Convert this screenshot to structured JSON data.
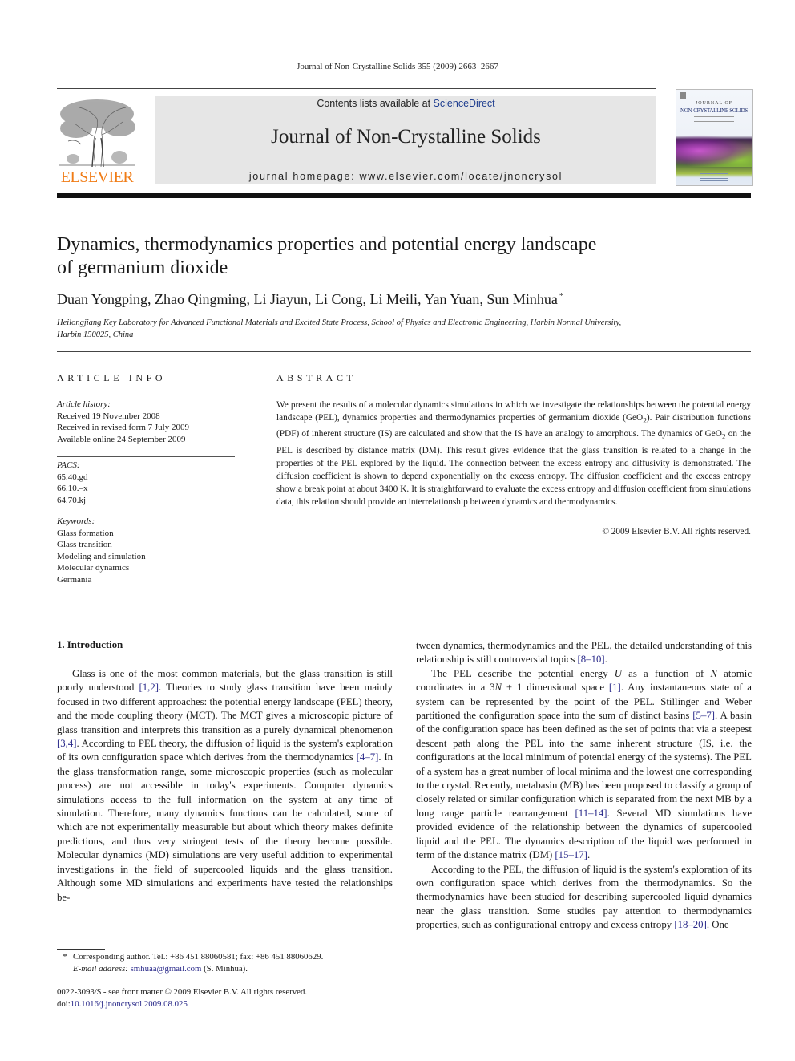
{
  "running_head": "Journal of Non-Crystalline Solids 355 (2009) 2663–2667",
  "masthead": {
    "publisher_logo_icon": "elsevier-tree-icon",
    "publisher_name": "ELSEVIER",
    "contents_prefix": "Contents lists available at ",
    "contents_link": "ScienceDirect",
    "journal_name": "Journal of Non-Crystalline Solids",
    "homepage": "journal homepage: www.elsevier.com/locate/jnoncrysol",
    "cover": {
      "title_line1": "JOURNAL OF",
      "title_line2": "NON-CRYSTALLINE SOLIDS"
    },
    "colors": {
      "publisher_orange": "#f07c16",
      "link_blue": "#1e3d8f",
      "banner_gray": "#e6e6e6"
    }
  },
  "article": {
    "title_line1": "Dynamics, thermodynamics properties and potential energy landscape",
    "title_line2": "of germanium dioxide",
    "authors": "Duan Yongping, Zhao Qingming, Li Jiayun, Li Cong, Li Meili, Yan Yuan, Sun Minhua",
    "corresponding_mark": "*",
    "affiliation_line1": "Heilongjiang Key Laboratory for Advanced Functional Materials and Excited State Process, School of Physics and Electronic Engineering, Harbin Normal University,",
    "affiliation_line2": "Harbin 150025, China"
  },
  "article_info": {
    "heading": "ARTICLE INFO",
    "history_label": "Article history:",
    "history": [
      "Received 19 November 2008",
      "Received in revised form 7 July 2009",
      "Available online 24 September 2009"
    ],
    "pacs_label": "PACS:",
    "pacs": [
      "65.40.gd",
      "66.10.–x",
      "64.70.kj"
    ],
    "keywords_label": "Keywords:",
    "keywords": [
      "Glass formation",
      "Glass transition",
      "Modeling and simulation",
      "Molecular dynamics",
      "Germania"
    ]
  },
  "abstract": {
    "heading": "ABSTRACT",
    "text_part1": "We present the results of a molecular dynamics simulations in which we investigate the relationships between the potential energy landscape (PEL), dynamics properties and thermodynamics properties of germanium dioxide (GeO",
    "sub1": "2",
    "text_part2": "). Pair distribution functions (PDF) of inherent structure (IS) are calculated and show that the IS have an analogy to amorphous. The dynamics of GeO",
    "sub2": "2",
    "text_part3": " on the PEL is described by distance matrix (DM). This result gives evidence that the glass transition is related to a change in the properties of the PEL explored by the liquid. The connection between the excess entropy and diffusivity is demonstrated. The diffusion coefficient is shown to depend exponentially on the excess entropy. The diffusion coefficient and the excess entropy show a break point at about 3400 K. It is straightforward to evaluate the excess entropy and diffusion coefficient from simulations data, this relation should provide an interrelationship between dynamics and thermodynamics.",
    "copyright": "© 2009 Elsevier B.V. All rights reserved."
  },
  "body": {
    "section_heading": "1. Introduction",
    "p1": [
      {
        "t": "Glass is one of the most common materials, but the glass transition is still poorly understood "
      },
      {
        "ref": "[1,2]"
      },
      {
        "t": ". Theories to study glass transition have been mainly focused in two different approaches: the potential energy landscape (PEL) theory, and the mode coupling theory (MCT). The MCT gives a microscopic picture of glass transition and interprets this transition as a purely dynamical phenomenon "
      },
      {
        "ref": "[3,4]"
      },
      {
        "t": ". According to PEL theory, the diffusion of liquid is the system's exploration of its own configuration space which derives from the thermodynamics "
      },
      {
        "ref": "[4–7]"
      },
      {
        "t": ". In the glass transformation range, some microscopic properties (such as molecular process) are not accessible in today's experiments. Computer dynamics simulations access to the full information on the system at any time of simulation. Therefore, many dynamics functions can be calculated, some of which are not experimentally measurable but about which theory makes definite predictions, and thus very stringent tests of the theory become possible. Molecular dynamics (MD) simulations are very useful addition to experimental investigations in the field of supercooled liquids and the glass transition. Although some MD simulations and experiments have tested the relationships be-"
      }
    ],
    "p1_cont": [
      {
        "t": "tween dynamics, thermodynamics and the PEL, the detailed understanding of this relationship is still controversial topics "
      },
      {
        "ref": "[8–10]"
      },
      {
        "t": "."
      }
    ],
    "p2": [
      {
        "t": "The PEL describe the potential energy "
      },
      {
        "i": "U"
      },
      {
        "t": " as a function of "
      },
      {
        "i": "N"
      },
      {
        "t": " atomic coordinates in a 3"
      },
      {
        "i": "N"
      },
      {
        "t": " + 1 dimensional space "
      },
      {
        "ref": "[1]"
      },
      {
        "t": ". Any instantaneous state of a system can be represented by the point of the PEL. Stillinger and Weber partitioned the configuration space into the sum of distinct basins "
      },
      {
        "ref": "[5–7]"
      },
      {
        "t": ". A basin of the configuration space has been defined as the set of points that via a steepest descent path along the PEL into the same inherent structure (IS, i.e. the configurations at the local minimum of potential energy of the systems). The PEL of a system has a great number of local minima and the lowest one corresponding to the crystal. Recently, metabasin (MB) has been proposed to classify a group of closely related or similar configuration which is separated from the next MB by a long range particle rearrangement "
      },
      {
        "ref": "[11–14]"
      },
      {
        "t": ". Several MD simulations have provided evidence of the relationship between the dynamics of supercooled liquid and the PEL. The dynamics description of the liquid was performed in term of the distance matrix (DM) "
      },
      {
        "ref": "[15–17]"
      },
      {
        "t": "."
      }
    ],
    "p3": [
      {
        "t": "According to the PEL, the diffusion of liquid is the system's exploration of its own configuration space which derives from the thermodynamics. So the thermodynamics have been studied for describing supercooled liquid dynamics near the glass transition. Some studies pay attention to thermodynamics properties, such as configurational entropy and excess entropy "
      },
      {
        "ref": "[18–20]"
      },
      {
        "t": ". One"
      }
    ]
  },
  "footnote": {
    "mark": "*",
    "line1": "Corresponding author. Tel.: +86 451 88060581; fax: +86 451 88060629.",
    "email_label": "E-mail address:",
    "email": "smhuaa@gmail.com",
    "email_suffix": " (S. Minhua)."
  },
  "front_matter": {
    "issn_line": "0022-3093/$ - see front matter © 2009 Elsevier B.V. All rights reserved.",
    "doi_prefix": "doi:",
    "doi": "10.1016/j.jnoncrysol.2009.08.025"
  }
}
